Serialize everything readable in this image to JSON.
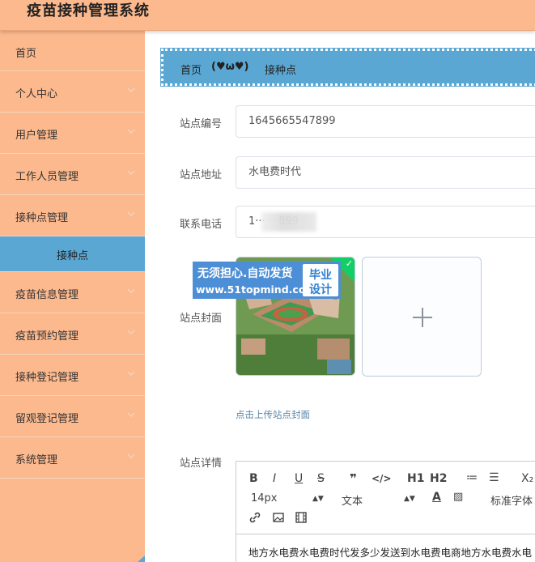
{
  "app": {
    "title": "疫苗接种管理系统"
  },
  "sidebar": {
    "items": [
      {
        "label": "首页",
        "has_chevron": false
      },
      {
        "label": "个人中心",
        "has_chevron": true
      },
      {
        "label": "用户管理",
        "has_chevron": true
      },
      {
        "label": "工作人员管理",
        "has_chevron": true
      },
      {
        "label": "接种点管理",
        "has_chevron": true
      },
      {
        "label": "疫苗信息管理",
        "has_chevron": true
      },
      {
        "label": "疫苗预约管理",
        "has_chevron": true
      },
      {
        "label": "接种登记管理",
        "has_chevron": true
      },
      {
        "label": "留观登记管理",
        "has_chevron": true
      },
      {
        "label": "系统管理",
        "has_chevron": true
      }
    ],
    "active_sub": "接种点"
  },
  "breadcrumb": {
    "home": "首页",
    "separator": "(♥ω♥)",
    "current": "接种点"
  },
  "form": {
    "station_no": {
      "label": "站点编号",
      "value": "1645665547899"
    },
    "station_addr": {
      "label": "站点地址",
      "value": "水电费时代"
    },
    "phone": {
      "label": "联系电话",
      "value": "1··· ···899"
    },
    "cover": {
      "label": "站点封面",
      "hint": "点击上传站点封面"
    },
    "details": {
      "label": "站点详情"
    }
  },
  "watermark": {
    "line1": "无须担心.自动发货",
    "line2": "www.51topmind.com",
    "badge_line1": "毕业",
    "badge_line2": "设计"
  },
  "editor": {
    "toolbar_row1": [
      "B",
      "I",
      "U",
      "S",
      "❞",
      "</>",
      "H1",
      "H2",
      "≔",
      "☰",
      "X₂"
    ],
    "font_size": "14px",
    "text_style": "文本",
    "font_family": "标准字体",
    "content": "地方水电费水电费时代发多少发送到水电费电商地方水电费水电"
  },
  "colors": {
    "accent_orange": "#fdb98e",
    "accent_blue": "#5aa7d4",
    "success_green": "#13ce66"
  }
}
